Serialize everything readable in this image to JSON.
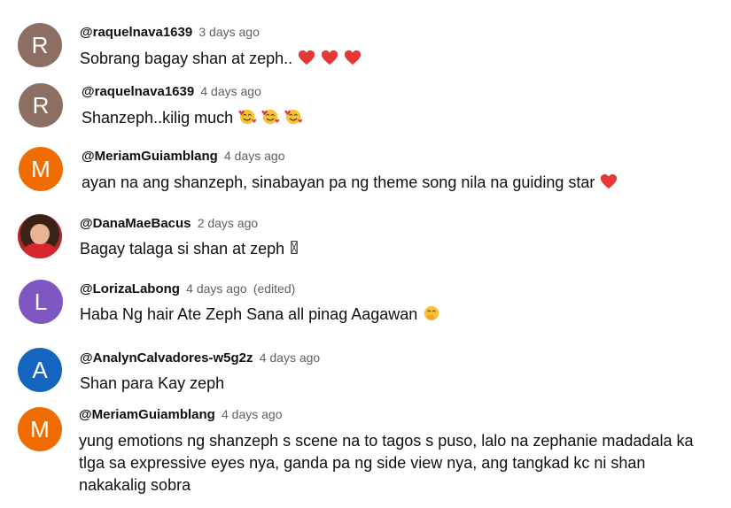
{
  "comments": [
    {
      "avatar_letter": "R",
      "avatar_color": "#8d6e63",
      "author": "@raquelnava1639",
      "time": "3 days ago",
      "edited": "",
      "text": "Sobrang bagay shan at zeph..",
      "emojis": [
        "heart-icon",
        "heart-icon",
        "heart-icon"
      ]
    },
    {
      "avatar_letter": "R",
      "avatar_color": "#8d6e63",
      "author": "@raquelnava1639",
      "time": "4 days ago",
      "edited": "",
      "text": "Shanzeph..kilig much",
      "emojis": [
        "smiling-face-with-hearts-icon",
        "smiling-face-with-hearts-icon",
        "smiling-face-with-hearts-icon"
      ]
    },
    {
      "avatar_letter": "M",
      "avatar_color": "#ef6c00",
      "author": "@MeriamGuiamblang",
      "time": "4 days ago",
      "edited": "",
      "text": "ayan na ang shanzeph, sinabayan pa ng theme song nila na guiding star",
      "emojis": [
        "heart-icon"
      ]
    },
    {
      "avatar_letter": "",
      "avatar_color": "#b02628",
      "author": "@DanaMaeBacus",
      "time": "2 days ago",
      "edited": "",
      "text": "Bagay talaga si shan at zeph",
      "emojis": [
        "missing-glyph-icon"
      ]
    },
    {
      "avatar_letter": "L",
      "avatar_color": "#7e57c2",
      "author": "@LorizaLabong",
      "time": "4 days ago",
      "edited": "(edited)",
      "text": "Haba Ng hair Ate Zeph Sana all pinag Aagawan",
      "emojis": [
        "face-with-hand-over-mouth-icon"
      ]
    },
    {
      "avatar_letter": "A",
      "avatar_color": "#1565c0",
      "author": "@AnalynCalvadores-w5g2z",
      "time": "4 days ago",
      "edited": "",
      "text": "Shan para Kay zeph",
      "emojis": []
    },
    {
      "avatar_letter": "M",
      "avatar_color": "#ef6c00",
      "author": "@MeriamGuiamblang",
      "time": "4 days ago",
      "edited": "",
      "text": "yung emotions ng shanzeph s scene na to tagos s puso, lalo na zephanie madadala ka tlga sa expressive eyes nya, ganda pa ng side view nya, ang tangkad kc ni shan nakakalig sobra",
      "emojis": []
    }
  ]
}
